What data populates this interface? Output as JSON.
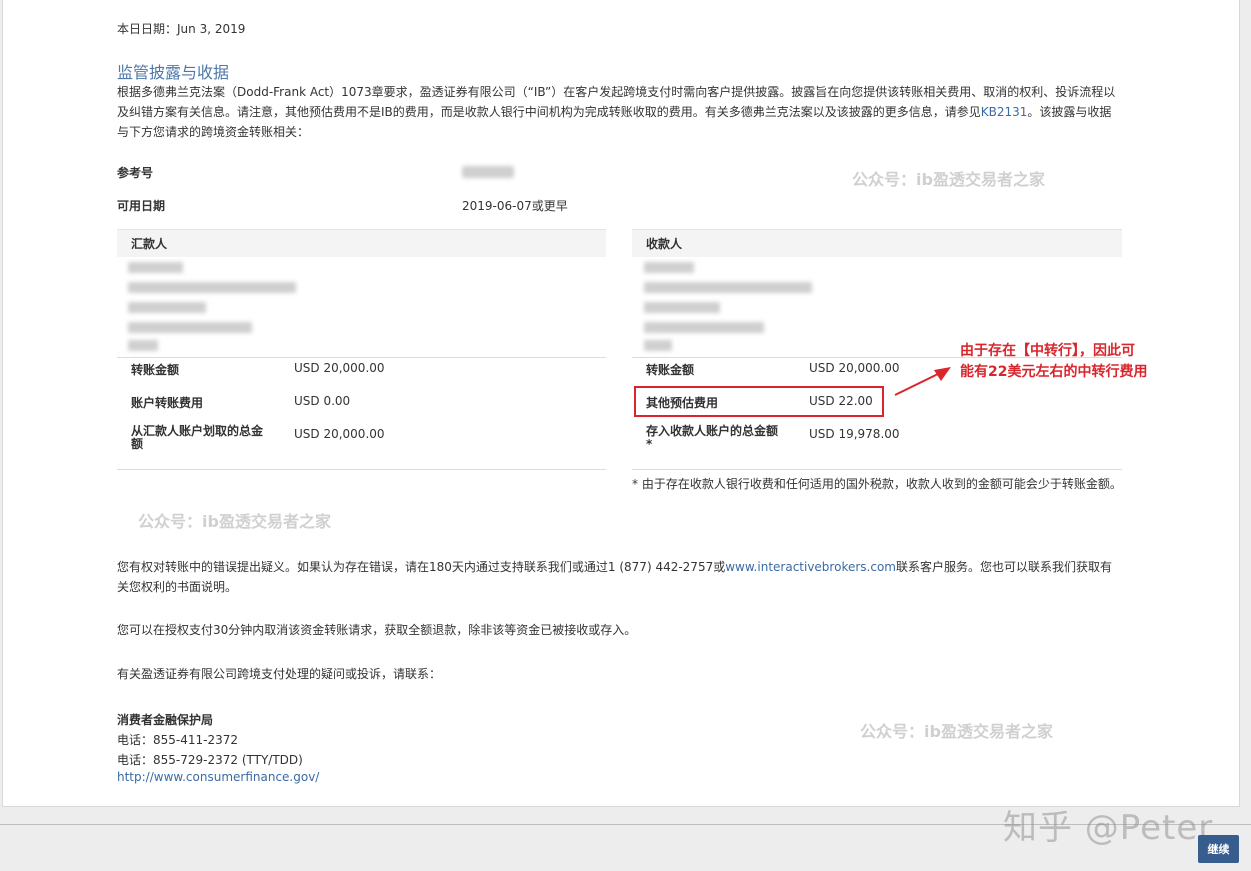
{
  "date_line": "本日日期：Jun 3, 2019",
  "section_title": "监管披露与收据",
  "intro": {
    "text_before_link": "根据多德弗兰克法案（Dodd-Frank Act）1073章要求，盈透证券有限公司（“IB”）在客户发起跨境支付时需向客户提供披露。披露旨在向您提供该转账相关费用、取消的权利、投诉流程以及纠错方案有关信息。请注意，其他预估费用不是IB的费用，而是收款人银行中间机构为完成转账收取的费用。有关多德弗兰克法案以及该披露的更多信息，请参见",
    "link": "KB2131",
    "text_after_link": "。该披露与收据与下方您请求的跨境资金转账相关："
  },
  "reference": {
    "label": "参考号"
  },
  "available_date": {
    "label": "可用日期",
    "value": "2019-06-07或更早"
  },
  "sender": {
    "header": "汇款人",
    "rows": [
      {
        "label": "转账金额",
        "value": "USD 20,000.00"
      },
      {
        "label": "账户转账费用",
        "value": "USD 0.00"
      },
      {
        "label": "从汇款人账户划取的总金额",
        "value": "USD 20,000.00"
      }
    ]
  },
  "recipient": {
    "header": "收款人",
    "rows": [
      {
        "label": "转账金额",
        "value": "USD 20,000.00"
      },
      {
        "label": "其他预估费用",
        "value": "USD 22.00"
      },
      {
        "label": "存入收款人账户的总金额*",
        "value": "USD 19,978.00"
      }
    ],
    "footnote": "* 由于存在收款人银行收费和任何适用的国外税款，收款人收到的金额可能会少于转账金额。"
  },
  "annotation": {
    "line1": "由于存在【中转行】，因此可",
    "line2": "能有22美元左右的中转行费用"
  },
  "watermark_text": "公众号：ib盈透交易者之家",
  "dispute": {
    "text_before_link": "您有权对转账中的错误提出疑义。如果认为存在错误，请在180天内通过支持联系我们或通过1 (877) 442-2757或",
    "link": "www.interactivebrokers.com",
    "text_after_link": "联系客户服务。您也可以联系我们获取有关您权利的书面说明。"
  },
  "cancel_text": "您可以在授权支付30分钟内取消该资金转账请求，获取全额退款，除非该等资金已被接收或存入。",
  "complaint_text": "有关盈透证券有限公司跨境支付处理的疑问或投诉，请联系：",
  "cfpb": {
    "name": "消费者金融保护局",
    "phone1": "电话：855-411-2372",
    "phone2": "电话：855-729-2372 (TTY/TDD)",
    "url": "http://www.consumerfinance.gov/"
  },
  "zhihu_watermark": "知乎 @Peter",
  "continue_label": "继续",
  "colors": {
    "accent": "#4e78a8",
    "link": "#3a6ba5",
    "annotation_red": "#d9262c",
    "button": "#375d8e"
  }
}
